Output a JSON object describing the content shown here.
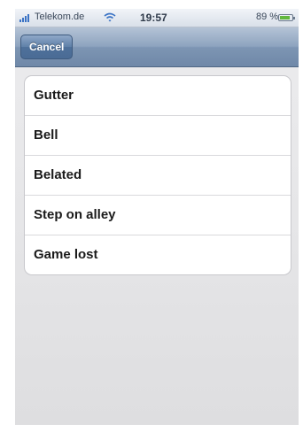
{
  "status_bar": {
    "carrier": "Telekom.de",
    "time": "19:57",
    "battery_percent": "89 %",
    "icons": [
      "signal-bars-icon",
      "wifi-icon",
      "battery-icon"
    ]
  },
  "nav_bar": {
    "cancel_label": "Cancel"
  },
  "list": {
    "items": [
      {
        "label": "Gutter"
      },
      {
        "label": "Bell"
      },
      {
        "label": "Belated"
      },
      {
        "label": "Step on alley"
      },
      {
        "label": "Game lost"
      }
    ]
  },
  "colors": {
    "nav_bar": "#8ea4bf",
    "cancel_button": "#5f80a8",
    "signal_bars": "#3b73c5",
    "battery_fill": "#62b83e",
    "background": "#e6e6e8"
  }
}
